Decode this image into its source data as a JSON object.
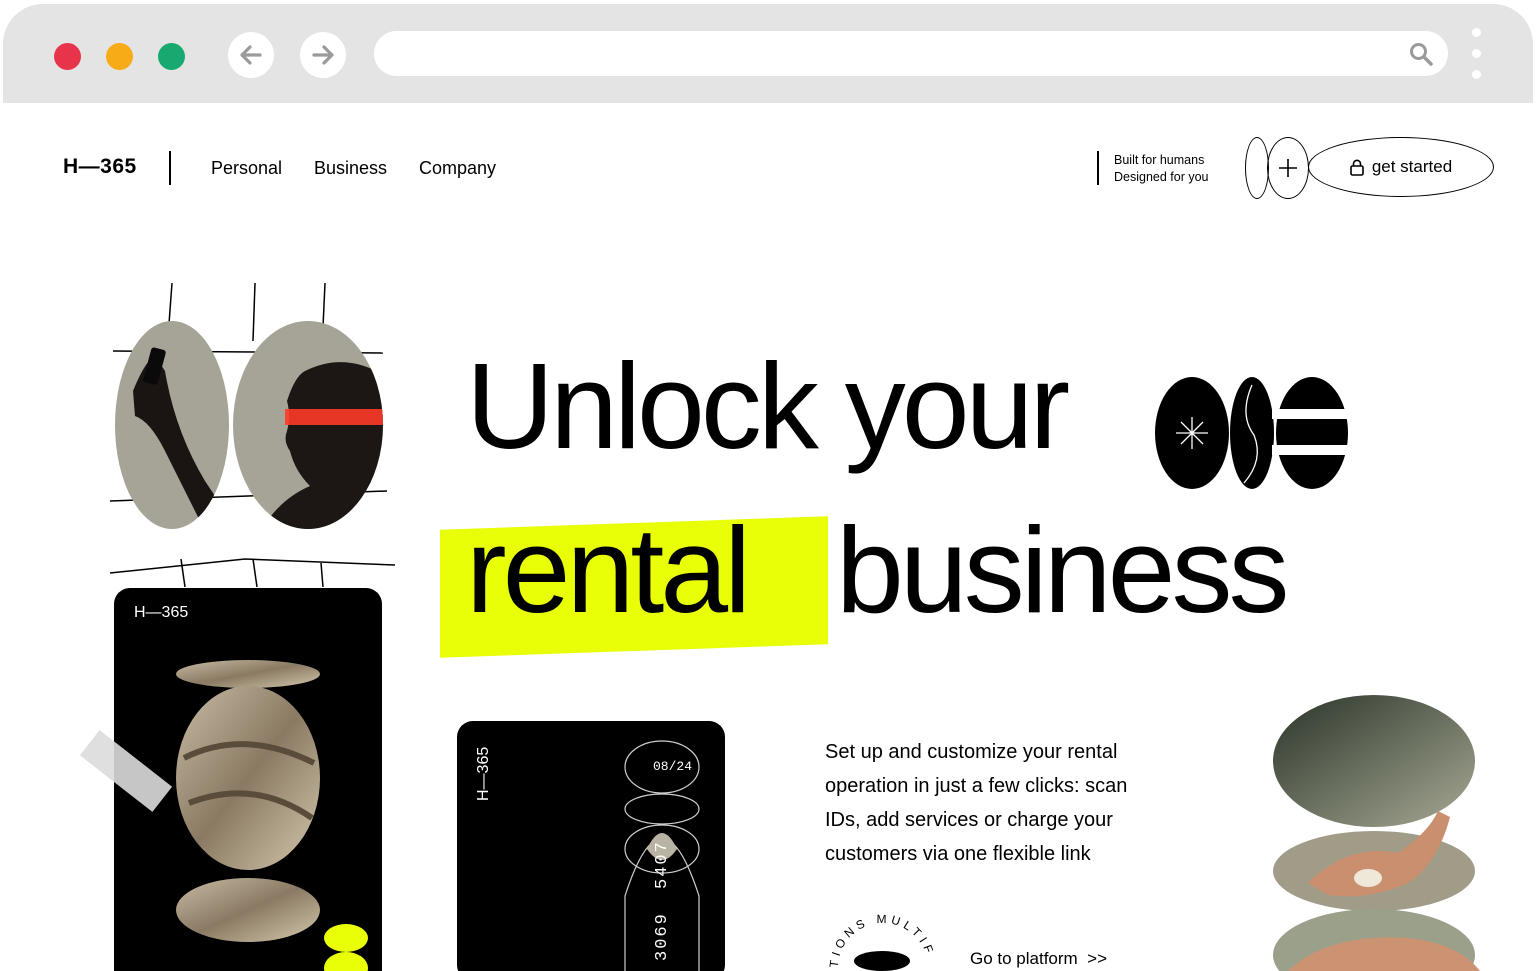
{
  "header": {
    "logo": "H—365",
    "nav": [
      "Personal",
      "Business",
      "Company"
    ],
    "tagline_line1": "Built for humans",
    "tagline_line2": "Designed for you",
    "cta_label": "get started"
  },
  "hero": {
    "line1": "Unlock your",
    "highlight": "rental",
    "line2_rest": "business"
  },
  "card_left": {
    "brand": "H—365"
  },
  "card_mid": {
    "brand": "H—365",
    "expiry": "08/24",
    "number_part1": "3069",
    "number_part2": "5407"
  },
  "description": "Set up and customize your rental operation in just a few clicks: scan IDs, add services or charge your customers via one flexible link",
  "badge_text": "TIONS MULTIF",
  "platform_link": "Go to platform",
  "colors": {
    "accent": "#e8ff08",
    "chrome": "#e4e4e4",
    "dot_red": "#e8344a",
    "dot_yellow": "#f7ab16",
    "dot_green": "#17a970"
  }
}
